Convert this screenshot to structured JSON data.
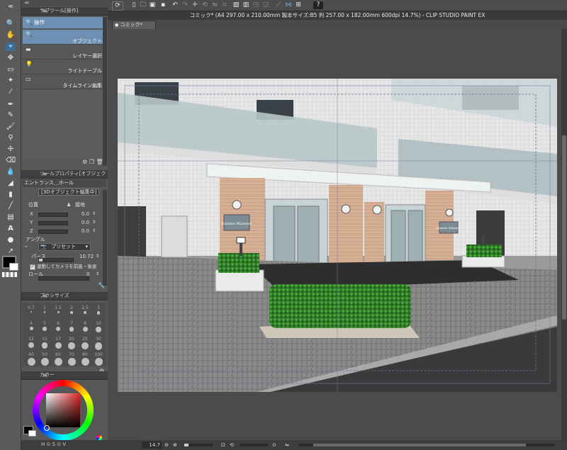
{
  "panels": {
    "subtool": {
      "title": "サブツール[操作]",
      "group_label": "操作",
      "items": [
        "オブジェクト",
        "レイヤー選択",
        "ライトテーブル",
        "タイムライン編集"
      ]
    },
    "toolprop": {
      "title": "ツールプロパティ[オブジェクト]",
      "object_name": "エントランス＿ホール",
      "section_label": "[3Dオブジェクト編集中]",
      "position_label": "位置",
      "ground_label": "接地",
      "axes": [
        {
          "label": "X",
          "value": "0.0"
        },
        {
          "label": "Y",
          "value": "0.0"
        },
        {
          "label": "Z",
          "value": "0.0"
        }
      ],
      "angle_label": "アングル",
      "preset_label": "プリセット",
      "perspective_label": "パース",
      "perspective_value": "10.72",
      "camera_follow_label": "連動してカメラを前進・後退",
      "roll_label": "ロール",
      "roll_value": "0"
    },
    "brushsize": {
      "title": "ブラシサイズ",
      "sizes": [
        "0.7",
        "1",
        "1.5",
        "2",
        "2.5",
        "3",
        "4",
        "5",
        "6",
        "7",
        "8",
        "10",
        "12",
        "15",
        "17",
        "20",
        "25",
        "30",
        "40",
        "50",
        "60",
        "70",
        "80",
        "100"
      ]
    },
    "color": {
      "title": "カラー",
      "main_color": "#ffffff",
      "sub_color": "#000000"
    }
  },
  "toolbar": {
    "icons": [
      "clip-logo-icon",
      "new-icon",
      "open-icon",
      "save-icon",
      "undo-icon",
      "redo-icon",
      "help-icon"
    ]
  },
  "window": {
    "title": "コミック* (A4 297.00 x 210.00mm 製本サイズ:B5 判 257.00 x 182.00mm 600dpi 14.7%)  - CLIP STUDIO PAINT EX",
    "doc_tab": "コミック*"
  },
  "status": {
    "zoom": "14.7"
  },
  "canvas": {
    "sign_left": "Katama Mansion",
    "sign_right": "Katama Mansion"
  },
  "colors": {
    "accent": "#3d6b94",
    "selected_item": "#6d8fb2"
  }
}
